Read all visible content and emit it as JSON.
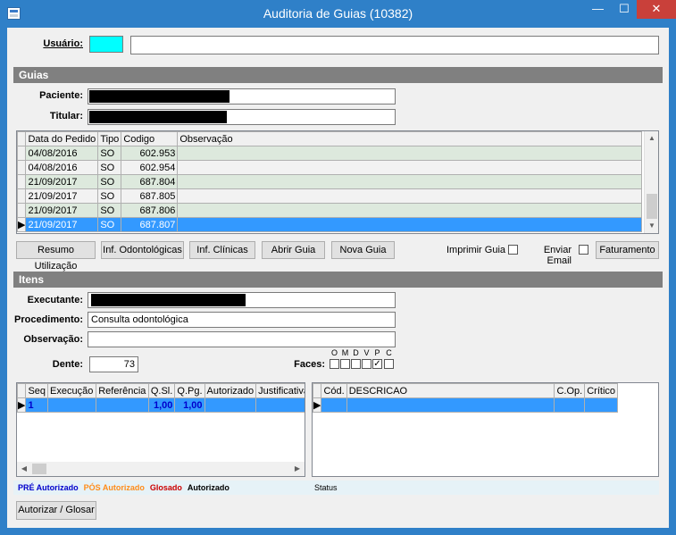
{
  "window": {
    "title": "Auditoria de Guias (10382)",
    "minimize_glyph": "—",
    "maximize_glyph": "☐",
    "close_glyph": "✕"
  },
  "usuario": {
    "label": "Usuário:",
    "name_value": ""
  },
  "guias": {
    "section_title": "Guias",
    "paciente_label": "Paciente:",
    "titular_label": "Titular:",
    "columns": [
      "Data do Pedido",
      "Tipo",
      "Codigo",
      "Observação"
    ],
    "rows": [
      {
        "date": "04/08/2016",
        "tipo": "SO",
        "codigo": "602.953",
        "obs": ""
      },
      {
        "date": "04/08/2016",
        "tipo": "SO",
        "codigo": "602.954",
        "obs": ""
      },
      {
        "date": "21/09/2017",
        "tipo": "SO",
        "codigo": "687.804",
        "obs": ""
      },
      {
        "date": "21/09/2017",
        "tipo": "SO",
        "codigo": "687.805",
        "obs": ""
      },
      {
        "date": "21/09/2017",
        "tipo": "SO",
        "codigo": "687.806",
        "obs": ""
      },
      {
        "date": "21/09/2017",
        "tipo": "SO",
        "codigo": "687.807",
        "obs": ""
      }
    ],
    "buttons": {
      "resumo": "Resumo Utilização",
      "odonto": "Inf. Odontológicas",
      "clinicas": "Inf. Clínicas",
      "abrir": "Abrir Guia",
      "nova": "Nova Guia",
      "faturamento": "Faturamento"
    },
    "imprimir_label": "Imprimir Guia",
    "enviar_label": "Enviar Email"
  },
  "itens": {
    "section_title": "Itens",
    "executante_label": "Executante:",
    "procedimento_label": "Procedimento:",
    "procedimento_value": "Consulta odontológica",
    "observacao_label": "Observação:",
    "observacao_value": "",
    "dente_label": "Dente:",
    "dente_value": "73",
    "faces_label": "Faces:",
    "faces": [
      {
        "letter": "O",
        "checked": false
      },
      {
        "letter": "M",
        "checked": false
      },
      {
        "letter": "D",
        "checked": false
      },
      {
        "letter": "V",
        "checked": false
      },
      {
        "letter": "P",
        "checked": true
      },
      {
        "letter": "C",
        "checked": false
      }
    ],
    "left_columns": [
      "Seq",
      "Execução",
      "Referência",
      "Q.Sl.",
      "Q.Pg.",
      "Autorizado",
      "Justificativa"
    ],
    "left_row": {
      "seq": "1",
      "execucao": "",
      "referencia": "",
      "qsl": "1,00",
      "qpg": "1,00",
      "autorizado": "",
      "justificativa": ""
    },
    "right_columns": [
      "Cód.",
      "DESCRICAO",
      "C.Op.",
      "Crítico"
    ]
  },
  "legend": {
    "pre": "PRÉ Autorizado",
    "pos": "PÓS Autorizado",
    "glosado": "Glosado",
    "autorizado": "Autorizado",
    "status": "Status"
  },
  "colors": {
    "pre": "#0000cc",
    "pos": "#ff8c1a",
    "glosado": "#cc0000",
    "autorizado": "#000000",
    "usuario_swatch": "#00ffff",
    "selection": "#3399ff"
  },
  "footer": {
    "autorizar_button": "Autorizar / Glosar"
  }
}
